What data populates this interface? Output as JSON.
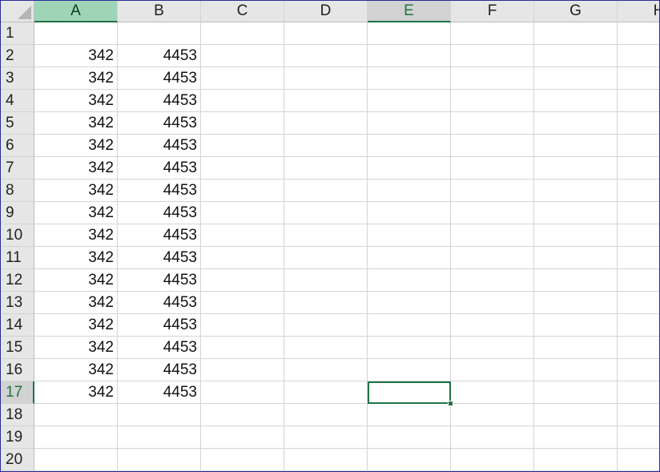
{
  "sheet": {
    "columns": [
      "A",
      "B",
      "C",
      "D",
      "E",
      "F",
      "G",
      "H"
    ],
    "rows": [
      "1",
      "2",
      "3",
      "4",
      "5",
      "6",
      "7",
      "8",
      "9",
      "10",
      "11",
      "12",
      "13",
      "14",
      "15",
      "16",
      "17",
      "18",
      "19",
      "20"
    ],
    "cells": {
      "A2": "342",
      "B2": "4453",
      "A3": "342",
      "B3": "4453",
      "A4": "342",
      "B4": "4453",
      "A5": "342",
      "B5": "4453",
      "A6": "342",
      "B6": "4453",
      "A7": "342",
      "B7": "4453",
      "A8": "342",
      "B8": "4453",
      "A9": "342",
      "B9": "4453",
      "A10": "342",
      "B10": "4453",
      "A11": "342",
      "B11": "4453",
      "A12": "342",
      "B12": "4453",
      "A13": "342",
      "B13": "4453",
      "A14": "342",
      "B14": "4453",
      "A15": "342",
      "B15": "4453",
      "A16": "342",
      "B16": "4453",
      "A17": "342",
      "B17": "4453"
    },
    "highlighted_column": "A",
    "active_cell": "E17",
    "colors": {
      "accent": "#217346",
      "header_bg": "#e6e6e6",
      "highlight_header_bg": "#9fd5b7",
      "gridline": "#d4d4d4"
    }
  }
}
